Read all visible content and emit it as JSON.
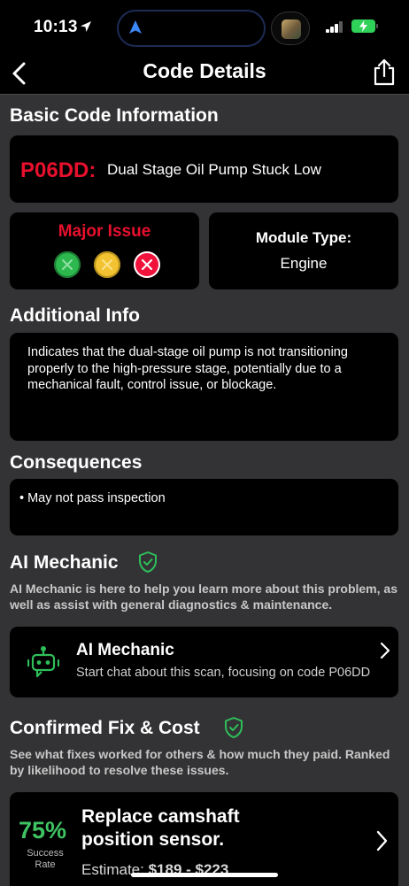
{
  "status_bar": {
    "time": "10:13"
  },
  "nav": {
    "title": "Code Details"
  },
  "basic": {
    "heading": "Basic Code Information",
    "code": "P06DD:",
    "description": "Dual Stage Oil Pump Stuck Low",
    "severity": "Major Issue",
    "module_label": "Module Type:",
    "module_value": "Engine"
  },
  "additional": {
    "heading": "Additional Info",
    "text": "Indicates that the dual-stage oil pump is not transitioning properly to the high-pressure stage, potentially due to a mechanical fault, control issue, or blockage."
  },
  "consequences": {
    "heading": "Consequences",
    "item": "• May not pass inspection"
  },
  "ai_mechanic": {
    "heading": "AI Mechanic",
    "description": "AI Mechanic is here to help you learn more about this problem, as well as assist with general diagnostics & maintenance.",
    "card_title": "AI Mechanic",
    "card_subtitle": "Start chat about this scan, focusing on code P06DD"
  },
  "confirmed_fix": {
    "heading": "Confirmed Fix & Cost",
    "description": "See what fixes worked for others & how much they paid. Ranked by likelihood to resolve these issues.",
    "success_rate": "75%",
    "success_label": "Success Rate",
    "title": "Replace camshaft position sensor.",
    "estimate_label": "Estimate:",
    "estimate_value": "$189 - $223"
  },
  "colors": {
    "accent_red": "#e8102d",
    "accent_green": "#3fc463",
    "shield_green": "#2fbf5a",
    "background": "#333335",
    "card": "#000000"
  },
  "icons": {
    "back": "chevron-left-icon",
    "share": "share-icon",
    "shield": "shield-check-icon",
    "bot": "robot-icon",
    "forward": "chevron-right-icon"
  }
}
